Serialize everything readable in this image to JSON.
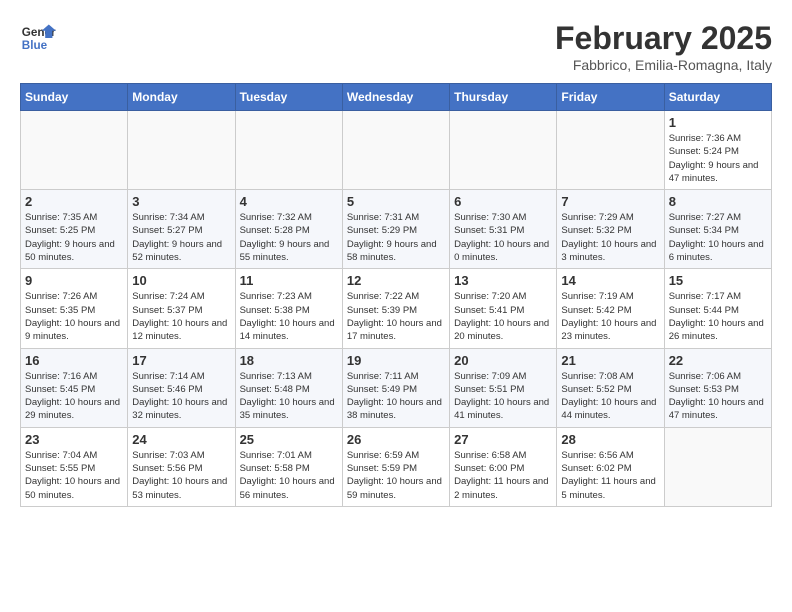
{
  "header": {
    "logo_line1": "General",
    "logo_line2": "Blue",
    "month_year": "February 2025",
    "location": "Fabbrico, Emilia-Romagna, Italy"
  },
  "days_of_week": [
    "Sunday",
    "Monday",
    "Tuesday",
    "Wednesday",
    "Thursday",
    "Friday",
    "Saturday"
  ],
  "weeks": [
    [
      {
        "day": "",
        "info": ""
      },
      {
        "day": "",
        "info": ""
      },
      {
        "day": "",
        "info": ""
      },
      {
        "day": "",
        "info": ""
      },
      {
        "day": "",
        "info": ""
      },
      {
        "day": "",
        "info": ""
      },
      {
        "day": "1",
        "info": "Sunrise: 7:36 AM\nSunset: 5:24 PM\nDaylight: 9 hours and 47 minutes."
      }
    ],
    [
      {
        "day": "2",
        "info": "Sunrise: 7:35 AM\nSunset: 5:25 PM\nDaylight: 9 hours and 50 minutes."
      },
      {
        "day": "3",
        "info": "Sunrise: 7:34 AM\nSunset: 5:27 PM\nDaylight: 9 hours and 52 minutes."
      },
      {
        "day": "4",
        "info": "Sunrise: 7:32 AM\nSunset: 5:28 PM\nDaylight: 9 hours and 55 minutes."
      },
      {
        "day": "5",
        "info": "Sunrise: 7:31 AM\nSunset: 5:29 PM\nDaylight: 9 hours and 58 minutes."
      },
      {
        "day": "6",
        "info": "Sunrise: 7:30 AM\nSunset: 5:31 PM\nDaylight: 10 hours and 0 minutes."
      },
      {
        "day": "7",
        "info": "Sunrise: 7:29 AM\nSunset: 5:32 PM\nDaylight: 10 hours and 3 minutes."
      },
      {
        "day": "8",
        "info": "Sunrise: 7:27 AM\nSunset: 5:34 PM\nDaylight: 10 hours and 6 minutes."
      }
    ],
    [
      {
        "day": "9",
        "info": "Sunrise: 7:26 AM\nSunset: 5:35 PM\nDaylight: 10 hours and 9 minutes."
      },
      {
        "day": "10",
        "info": "Sunrise: 7:24 AM\nSunset: 5:37 PM\nDaylight: 10 hours and 12 minutes."
      },
      {
        "day": "11",
        "info": "Sunrise: 7:23 AM\nSunset: 5:38 PM\nDaylight: 10 hours and 14 minutes."
      },
      {
        "day": "12",
        "info": "Sunrise: 7:22 AM\nSunset: 5:39 PM\nDaylight: 10 hours and 17 minutes."
      },
      {
        "day": "13",
        "info": "Sunrise: 7:20 AM\nSunset: 5:41 PM\nDaylight: 10 hours and 20 minutes."
      },
      {
        "day": "14",
        "info": "Sunrise: 7:19 AM\nSunset: 5:42 PM\nDaylight: 10 hours and 23 minutes."
      },
      {
        "day": "15",
        "info": "Sunrise: 7:17 AM\nSunset: 5:44 PM\nDaylight: 10 hours and 26 minutes."
      }
    ],
    [
      {
        "day": "16",
        "info": "Sunrise: 7:16 AM\nSunset: 5:45 PM\nDaylight: 10 hours and 29 minutes."
      },
      {
        "day": "17",
        "info": "Sunrise: 7:14 AM\nSunset: 5:46 PM\nDaylight: 10 hours and 32 minutes."
      },
      {
        "day": "18",
        "info": "Sunrise: 7:13 AM\nSunset: 5:48 PM\nDaylight: 10 hours and 35 minutes."
      },
      {
        "day": "19",
        "info": "Sunrise: 7:11 AM\nSunset: 5:49 PM\nDaylight: 10 hours and 38 minutes."
      },
      {
        "day": "20",
        "info": "Sunrise: 7:09 AM\nSunset: 5:51 PM\nDaylight: 10 hours and 41 minutes."
      },
      {
        "day": "21",
        "info": "Sunrise: 7:08 AM\nSunset: 5:52 PM\nDaylight: 10 hours and 44 minutes."
      },
      {
        "day": "22",
        "info": "Sunrise: 7:06 AM\nSunset: 5:53 PM\nDaylight: 10 hours and 47 minutes."
      }
    ],
    [
      {
        "day": "23",
        "info": "Sunrise: 7:04 AM\nSunset: 5:55 PM\nDaylight: 10 hours and 50 minutes."
      },
      {
        "day": "24",
        "info": "Sunrise: 7:03 AM\nSunset: 5:56 PM\nDaylight: 10 hours and 53 minutes."
      },
      {
        "day": "25",
        "info": "Sunrise: 7:01 AM\nSunset: 5:58 PM\nDaylight: 10 hours and 56 minutes."
      },
      {
        "day": "26",
        "info": "Sunrise: 6:59 AM\nSunset: 5:59 PM\nDaylight: 10 hours and 59 minutes."
      },
      {
        "day": "27",
        "info": "Sunrise: 6:58 AM\nSunset: 6:00 PM\nDaylight: 11 hours and 2 minutes."
      },
      {
        "day": "28",
        "info": "Sunrise: 6:56 AM\nSunset: 6:02 PM\nDaylight: 11 hours and 5 minutes."
      },
      {
        "day": "",
        "info": ""
      }
    ]
  ]
}
